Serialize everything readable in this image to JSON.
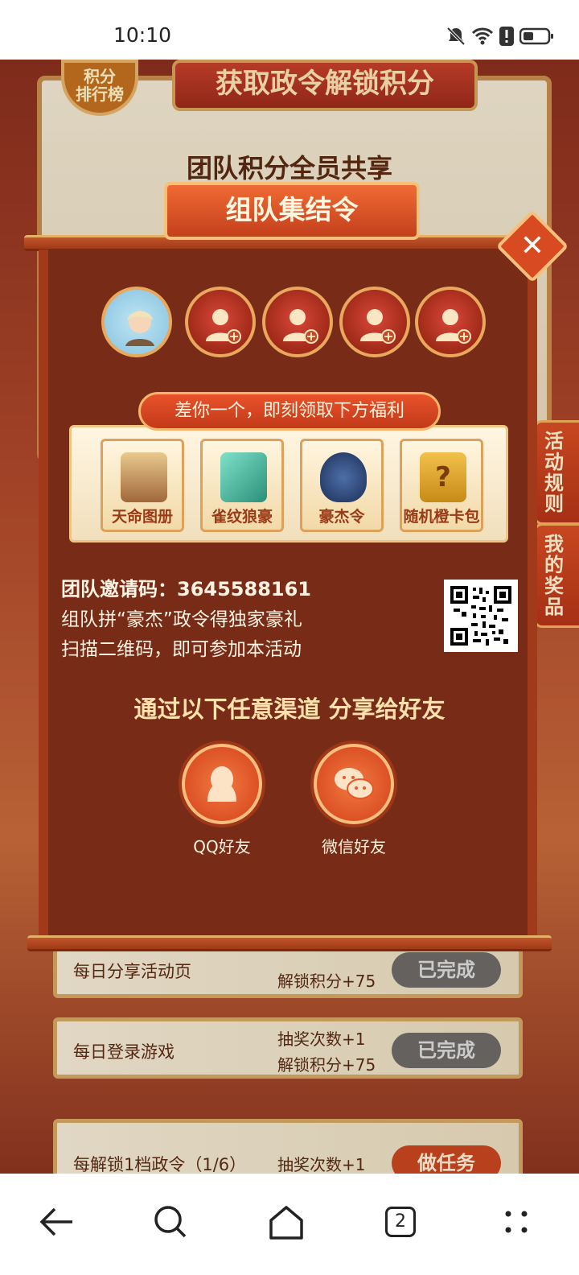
{
  "status_bar": {
    "time": "10:10"
  },
  "background": {
    "rank_badge": "积分\n排行榜",
    "banner_title": "获取政令解锁积分",
    "panel_line1": "团队积分全员共享",
    "side_tab_rules": "活动\n规则",
    "side_tab_prizes": "我的\n奖品",
    "tasks": [
      {
        "name": "每日分享活动页",
        "reward2": "解锁积分+75",
        "button": "已完成"
      },
      {
        "name": "每日登录游戏",
        "reward1": "抽奖次数+1",
        "reward2": "解锁积分+75",
        "button": "已完成"
      },
      {
        "name": "每解锁1档政令（1/6）",
        "reward1": "抽奖次数+1",
        "button": "做任务"
      }
    ]
  },
  "modal": {
    "title": "组队集结令",
    "ribbon": "差你一个，即刻领取下方福利",
    "rewards": [
      {
        "label": "天命图册",
        "icon": "pagoda-scroll-icon"
      },
      {
        "label": "雀纹狼豪",
        "icon": "feather-brush-icon"
      },
      {
        "label": "豪杰令",
        "icon": "emblem-shield-icon"
      },
      {
        "label": "随机橙卡包",
        "icon": "mystery-card-icon"
      }
    ],
    "invite_label": "团队邀请码：",
    "invite_code": "3645588161",
    "invite_line2": "组队拼“豪杰”政令得独家豪礼",
    "invite_line3": "扫描二维码，即可参加本活动",
    "share_heading": "通过以下任意渠道 分享给好友",
    "share_qq": "QQ好友",
    "share_wechat": "微信好友"
  },
  "nav": {
    "tabs_count": "2"
  }
}
